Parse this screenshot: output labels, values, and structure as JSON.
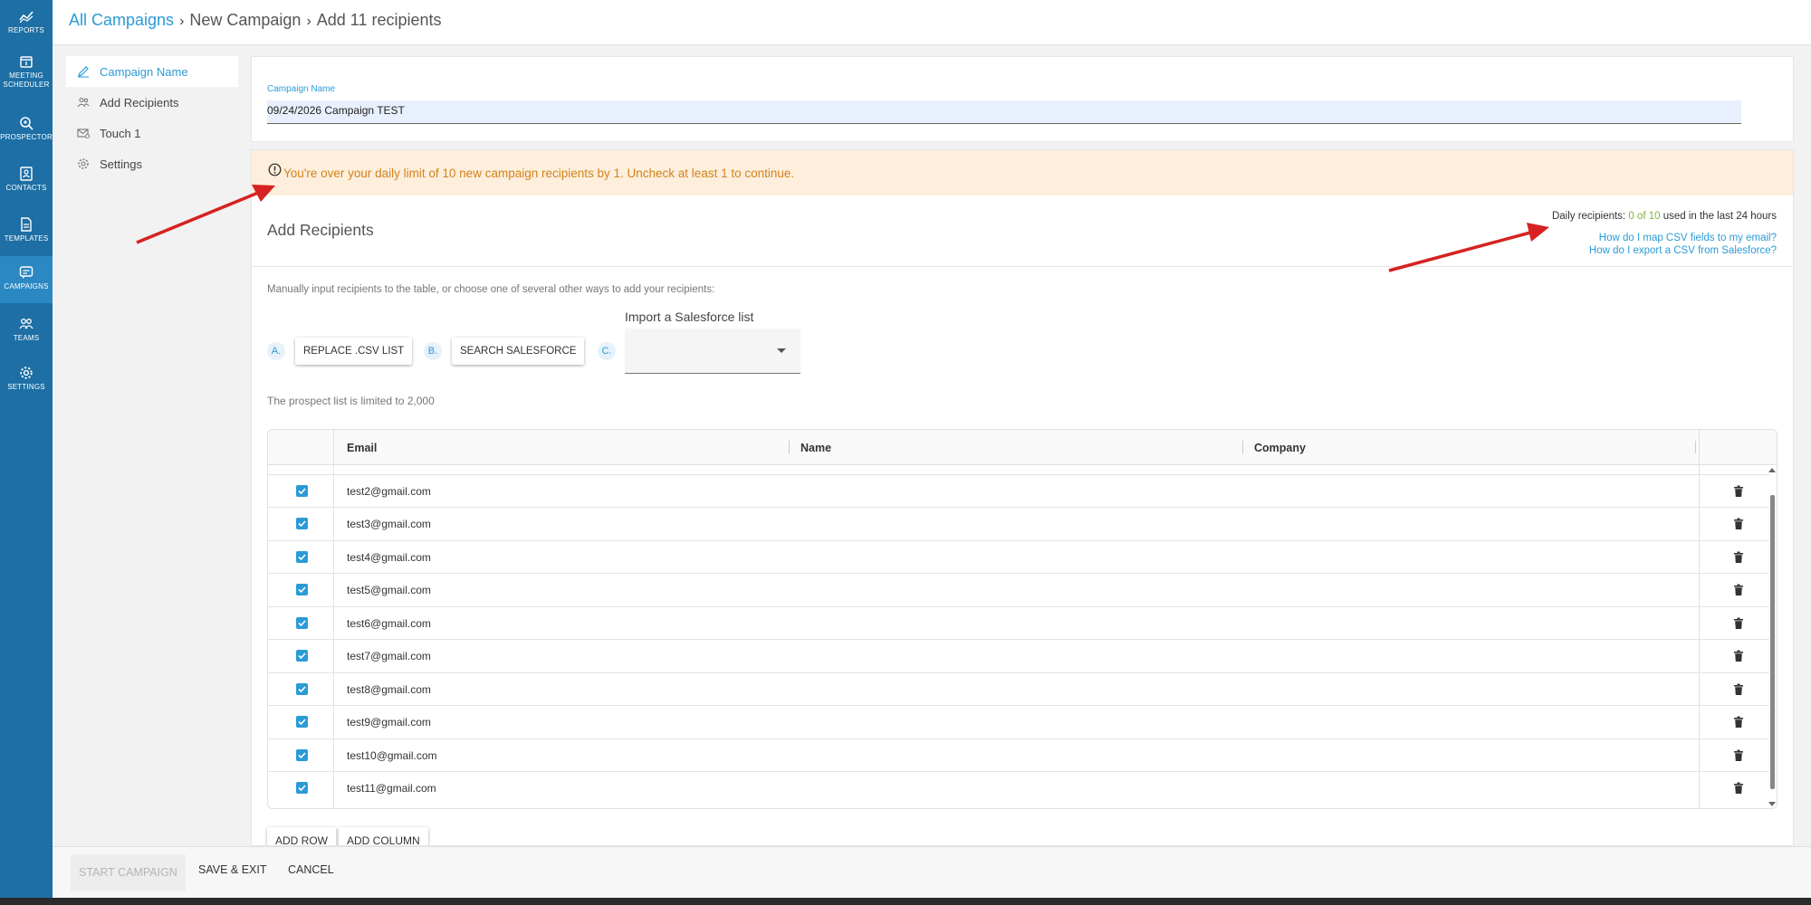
{
  "nav": {
    "items": [
      {
        "label": "REPORTS",
        "icon": "reports-icon"
      },
      {
        "label": "MEETING SCHEDULER",
        "icon": "calendar-icon"
      },
      {
        "label": "PROSPECTOR",
        "icon": "prospector-icon"
      },
      {
        "label": "CONTACTS",
        "icon": "contacts-icon"
      },
      {
        "label": "TEMPLATES",
        "icon": "templates-icon"
      },
      {
        "label": "CAMPAIGNS",
        "icon": "campaigns-icon",
        "active": true
      },
      {
        "label": "TEAMS",
        "icon": "teams-icon"
      },
      {
        "label": "SETTINGS",
        "icon": "settings-icon"
      }
    ],
    "meeting_line1": "MEETING",
    "meeting_line2": "SCHEDULER"
  },
  "breadcrumb": {
    "root": "All Campaigns",
    "middle": "New Campaign",
    "current": "Add 11 recipients"
  },
  "steps": [
    {
      "label": "Campaign Name",
      "icon": "pencil-icon",
      "active": true
    },
    {
      "label": "Add Recipients",
      "icon": "people-icon"
    },
    {
      "label": "Touch 1",
      "icon": "email-icon"
    },
    {
      "label": "Settings",
      "icon": "gear-icon"
    }
  ],
  "campaign_name": {
    "label": "Campaign Name",
    "value": "09/24/2026 Campaign TEST"
  },
  "warning": {
    "text": "You're over your daily limit of 10 new campaign recipients by 1. Uncheck at least 1 to continue.",
    "color": "#d4821e"
  },
  "recipients": {
    "title": "Add Recipients",
    "daily_prefix": "Daily recipients: ",
    "daily_count": "0 of 10",
    "daily_suffix": " used in the last 24 hours",
    "help_link_1": "How do I map CSV fields to my email?",
    "help_link_2": "How do I export a CSV from Salesforce?",
    "manual_text": "Manually input recipients to the table, or choose one of several other ways to add your recipients:",
    "option_a": "A.",
    "option_b": "B.",
    "option_c": "C.",
    "replace_csv": "REPLACE .CSV LIST",
    "search_sf": "SEARCH SALESFORCE",
    "sf_list_label": "Import a Salesforce list",
    "limit_text": "The prospect list is limited to 2,000"
  },
  "table": {
    "columns": [
      "Email",
      "Name",
      "Company"
    ],
    "rows": [
      {
        "email": "test2@gmail.com",
        "checked": true
      },
      {
        "email": "test3@gmail.com",
        "checked": true
      },
      {
        "email": "test4@gmail.com",
        "checked": true
      },
      {
        "email": "test5@gmail.com",
        "checked": true
      },
      {
        "email": "test6@gmail.com",
        "checked": true
      },
      {
        "email": "test7@gmail.com",
        "checked": true
      },
      {
        "email": "test8@gmail.com",
        "checked": true
      },
      {
        "email": "test9@gmail.com",
        "checked": true
      },
      {
        "email": "test10@gmail.com",
        "checked": true
      },
      {
        "email": "test11@gmail.com",
        "checked": true
      }
    ]
  },
  "table_actions": {
    "add_row": "ADD ROW",
    "add_column": "ADD COLUMN"
  },
  "footer": {
    "start": "START CAMPAIGN",
    "save_exit": "SAVE & EXIT",
    "cancel": "CANCEL"
  },
  "colors": {
    "rail": "#1d6fa5",
    "accent": "#2b9bd6",
    "warning_bg": "#fdefdc",
    "annotation_arrow": "#d62222"
  }
}
